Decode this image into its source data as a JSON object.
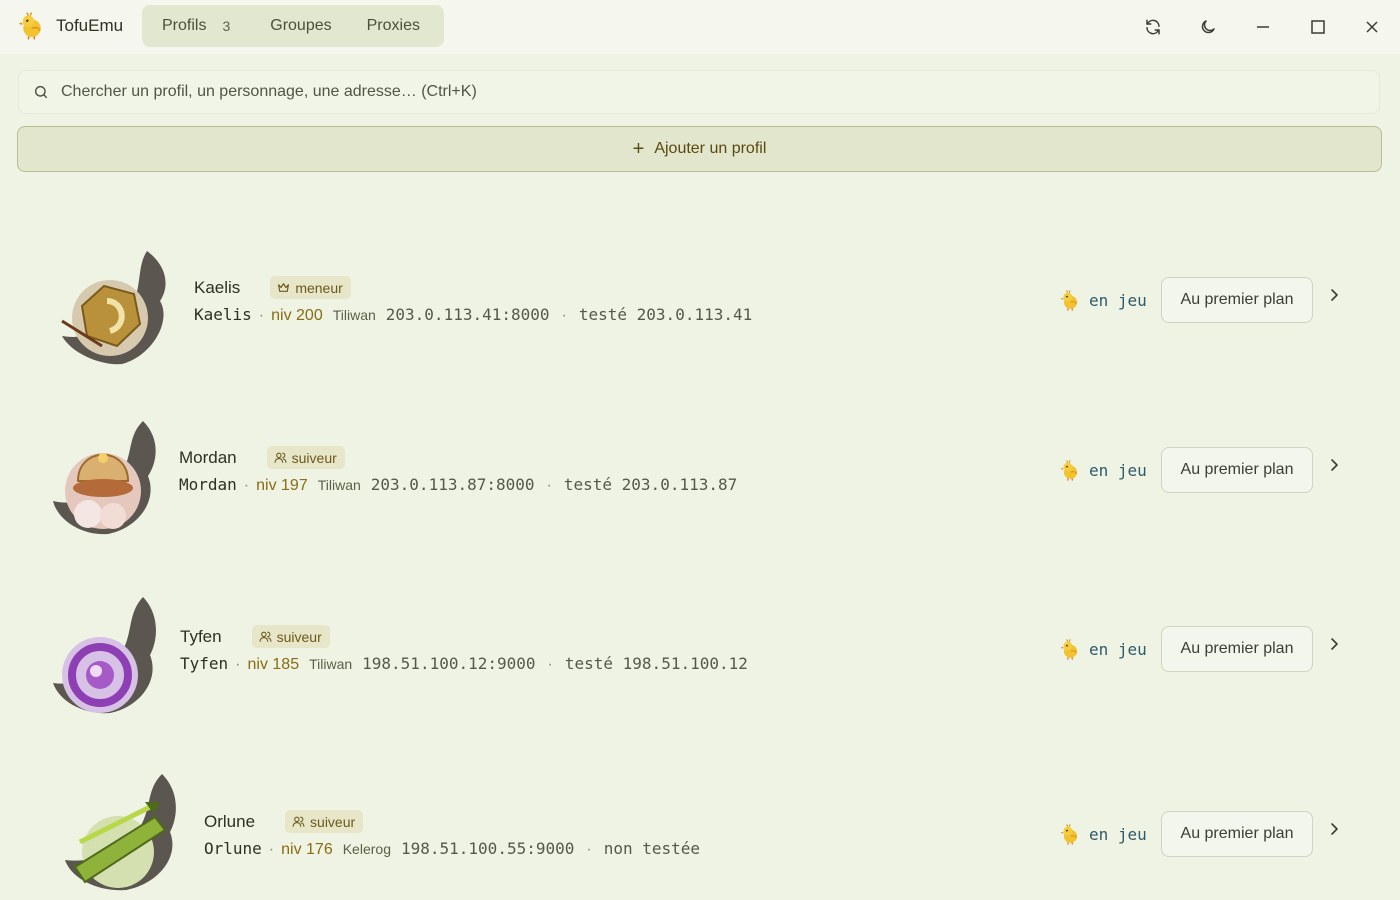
{
  "app": {
    "name": "TofuEmu"
  },
  "nav": {
    "tabs": [
      {
        "label": "Profils",
        "count": "3"
      },
      {
        "label": "Groupes"
      },
      {
        "label": "Proxies"
      }
    ]
  },
  "window_controls": [
    "refresh-icon",
    "moon-icon",
    "minimize-icon",
    "maximize-icon",
    "close-icon"
  ],
  "search": {
    "placeholder": "Chercher un profil, un personnage, une adresse… (Ctrl+K)",
    "value": ""
  },
  "add_profile": {
    "label": "Ajouter un profil"
  },
  "profiles": [
    {
      "name": "Kaelis",
      "role": "meneur",
      "role_icon": "crown-icon",
      "character": "Kaelis",
      "level": "niv 200",
      "server": "Tiliwan",
      "address": "203.0.113.41:8000",
      "tested": "testé 203.0.113.41",
      "status": "en jeu",
      "action": "Au premier plan"
    },
    {
      "name": "Mordan",
      "role": "suiveur",
      "role_icon": "users-icon",
      "character": "Mordan",
      "level": "niv 197",
      "server": "Tiliwan",
      "address": "203.0.113.87:8000",
      "tested": "testé 203.0.113.87",
      "status": "en jeu",
      "action": "Au premier plan"
    },
    {
      "name": "Tyfen",
      "role": "suiveur",
      "role_icon": "users-icon",
      "character": "Tyfen",
      "level": "niv 185",
      "server": "Tiliwan",
      "address": "198.51.100.12:9000",
      "tested": "testé 198.51.100.12",
      "status": "en jeu",
      "action": "Au premier plan"
    },
    {
      "name": "Orlune",
      "role": "suiveur",
      "role_icon": "users-icon",
      "character": "Orlune",
      "level": "niv 176",
      "server": "Kelerog",
      "address": "198.51.100.55:9000",
      "tested": "non testée",
      "status": "en jeu",
      "action": "Au premier plan"
    }
  ],
  "colors": {
    "background": "#eef3e3",
    "accent": "#8a6c12",
    "status": "#2e5a6b"
  }
}
